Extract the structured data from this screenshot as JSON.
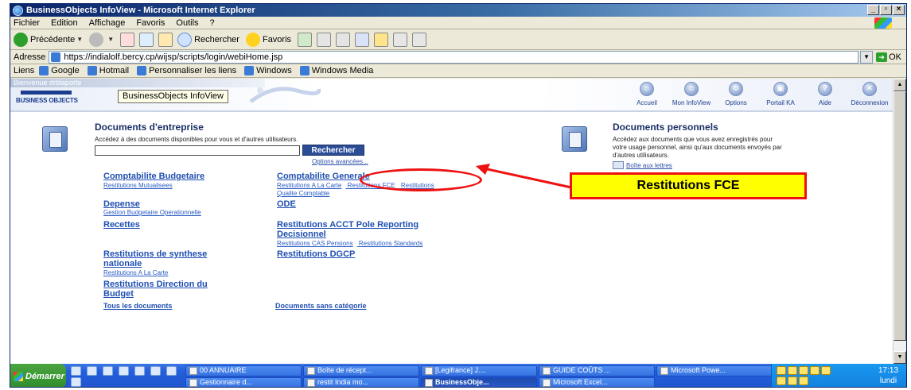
{
  "window": {
    "title": "BusinessObjects InfoView - Microsoft Internet Explorer",
    "min": "_",
    "max": "▫",
    "close": "×"
  },
  "menu": [
    "Fichier",
    "Edition",
    "Affichage",
    "Favoris",
    "Outils",
    "?"
  ],
  "toolbar": {
    "back": "Précédente",
    "search": "Rechercher",
    "favorites": "Favoris"
  },
  "address": {
    "label": "Adresse",
    "url": "https://indialolf.bercy.cp/wijsp/scripts/login/webiHome.jsp",
    "go": "OK"
  },
  "links": {
    "label": "Liens",
    "items": [
      "Google",
      "Hotmail",
      "Personnaliser les liens",
      "Windows",
      "Windows Media"
    ]
  },
  "bo": {
    "welcome": "Bienvenue drblaporte",
    "logo": "BUSINESS OBJECTS",
    "page_title": "BusinessObjects InfoView",
    "nav": [
      {
        "label": "Accueil",
        "glyph": "⌂"
      },
      {
        "label": "Mon InfoView",
        "glyph": "☺"
      },
      {
        "label": "Options",
        "glyph": "⚙"
      },
      {
        "label": "Portail KA",
        "glyph": "▣"
      },
      {
        "label": "Aide",
        "glyph": "?"
      },
      {
        "label": "Déconnexion",
        "glyph": "✕"
      }
    ]
  },
  "enterprise": {
    "title": "Documents d'entreprise",
    "desc": "Accédez à des documents disponibles pour vous et d'autres utilisateurs.",
    "search_value": "",
    "search_button": "Rechercher",
    "advanced": "Options avancées...",
    "categories": {
      "c1": {
        "title": "Comptabilite Budgetaire",
        "subs": [
          "Restitutions Mutualisees"
        ]
      },
      "c2": {
        "title": "Comptabilite Generale",
        "subs": [
          "Restitutions A La Carte",
          "Restitutions FCE",
          "Restitutions"
        ],
        "subs2": [
          "Qualite Comptable"
        ]
      },
      "c3": {
        "title": "Depense",
        "subs": [
          "Gestion Budgetaire Operationnelle"
        ]
      },
      "c4": {
        "title": "ODE"
      },
      "c5": {
        "title": "Recettes"
      },
      "c6": {
        "title_l1": "Restitutions ACCT Pole Reporting",
        "title_l2": "Decisionnel",
        "subs": [
          "Restitutions CAS Pensions",
          "Restitutions Standards"
        ]
      },
      "c7": {
        "title_l1": "Restitutions de synthese",
        "title_l2": "nationale",
        "subs": [
          "Restitutions A La Carte"
        ]
      },
      "c8": {
        "title": "Restitutions DGCP"
      },
      "c9": {
        "title_l1": "Restitutions Direction du",
        "title_l2": "Budget"
      }
    },
    "all_docs": "Tous les documents",
    "uncategorized": "Documents sans catégorie"
  },
  "personal": {
    "title": "Documents personnels",
    "desc_l1": "Accédez aux documents que vous avez enregistrés pour",
    "desc_l2": "votre usage personnel, ainsi qu'aux documents envoyés par",
    "desc_l3": "d'autres utilisateurs.",
    "inbox": "Boîte aux lettres"
  },
  "callout": {
    "label": "Restitutions FCE",
    "color": "#ffff00",
    "border": "#ee1111"
  },
  "taskbar": {
    "start": "Démarrer",
    "tasks": [
      "00 ANNUAIRE",
      "Boîte de récept...",
      "[Legifrance] J....",
      "GUIDE COÛTS ...",
      "Microsoft Powe...",
      "Gestionnaire d...",
      "restit India mo...",
      "BusinessObje...",
      "Microsoft Excel..."
    ],
    "time": "17:13",
    "day": "lundi"
  }
}
